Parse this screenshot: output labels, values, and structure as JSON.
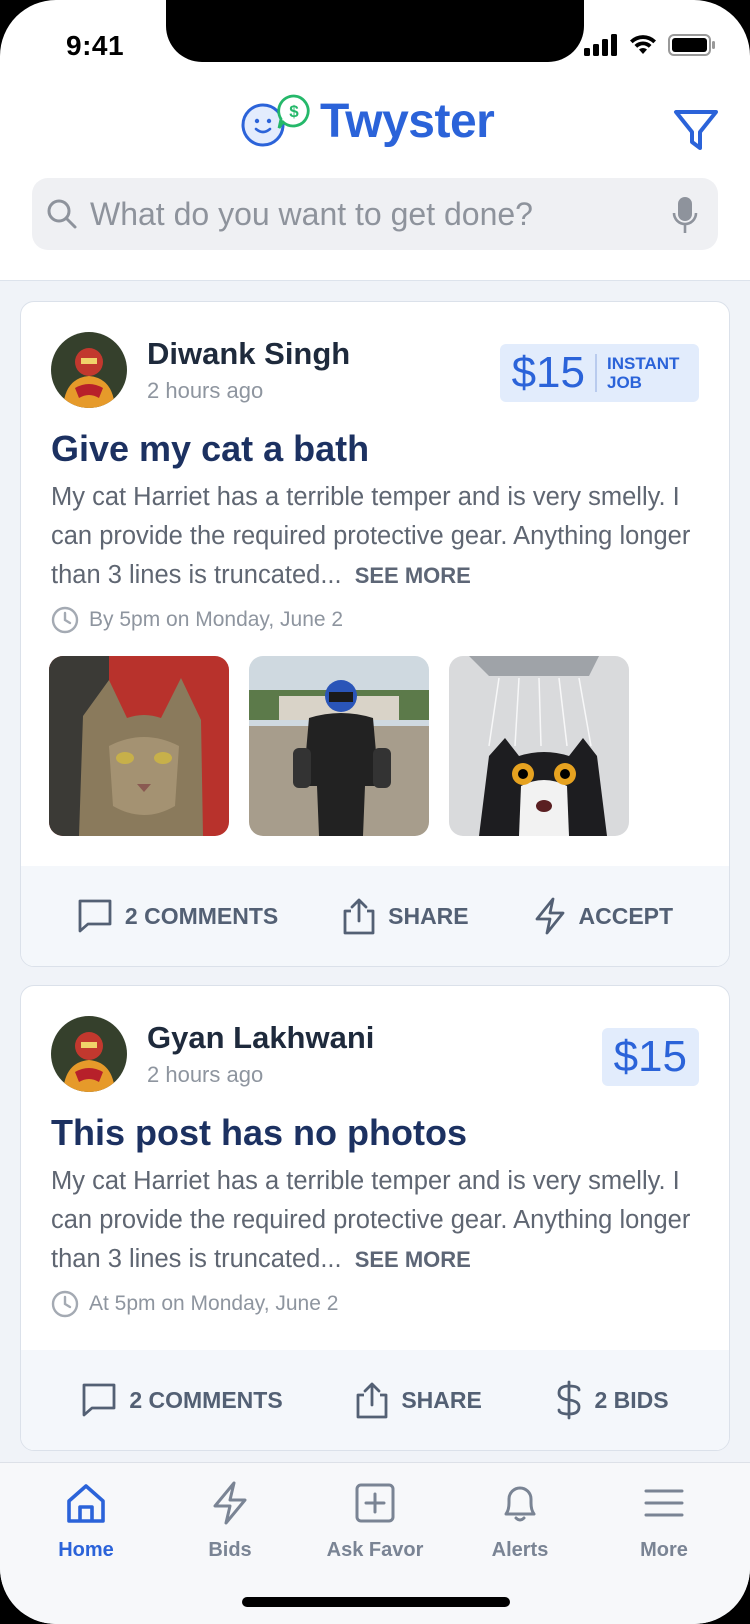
{
  "status_bar": {
    "time": "9:41"
  },
  "header": {
    "app_name": "Twyster"
  },
  "search": {
    "placeholder": "What do you want to get done?"
  },
  "posts": [
    {
      "author": "Diwank Singh",
      "posted": "2 hours ago",
      "price": "$15",
      "tag": "INSTANT JOB",
      "title": "Give my cat a bath",
      "body": "My cat Harriet has a terrible temper and is very smelly. I can provide the required protective gear. Anything longer than 3 lines is truncated...",
      "see_more": "SEE MORE",
      "deadline": "By 5pm on Monday, June 2",
      "photos": [
        "cat-portrait",
        "protective-gear",
        "wet-cat-shower"
      ],
      "actions": [
        "2 COMMENTS",
        "SHARE",
        "ACCEPT"
      ]
    },
    {
      "author": "Gyan Lakhwani",
      "posted": "2 hours ago",
      "price": "$15",
      "title": "This post has no photos",
      "body": "My cat Harriet has a terrible temper and is very smelly. I can provide the required protective gear. Anything longer than 3 lines is truncated...",
      "see_more": "SEE MORE",
      "deadline": "At 5pm on Monday, June 2",
      "actions": [
        "2 COMMENTS",
        "SHARE",
        "2 BIDS"
      ]
    }
  ],
  "tabs": [
    {
      "label": "Home",
      "icon": "home-icon",
      "active": true
    },
    {
      "label": "Bids",
      "icon": "bolt-icon"
    },
    {
      "label": "Ask Favor",
      "icon": "plus-square-icon"
    },
    {
      "label": "Alerts",
      "icon": "bell-icon"
    },
    {
      "label": "More",
      "icon": "menu-icon"
    }
  ],
  "colors": {
    "accent": "#2b63d9",
    "title": "#1c3161",
    "feed_bg": "#f0f3f8",
    "price_bg": "#e2ecfc"
  }
}
